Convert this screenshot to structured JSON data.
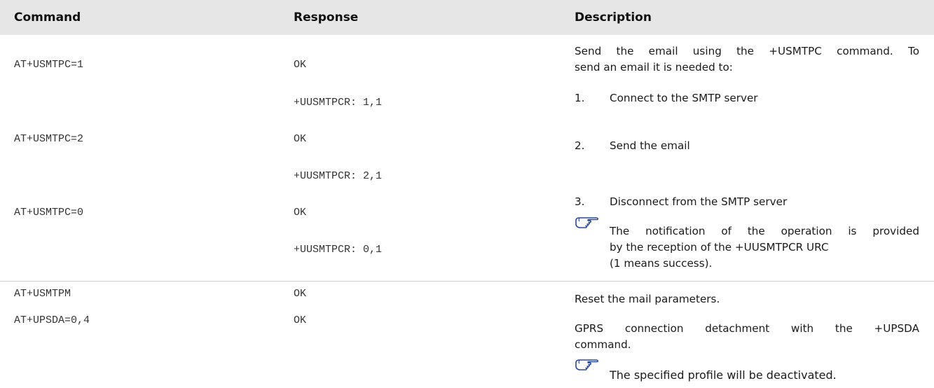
{
  "header": {
    "command": "Command",
    "response": "Response",
    "description": "Description"
  },
  "group1": {
    "rows": [
      {
        "command": "AT+USMTPC=1",
        "response": "OK"
      },
      {
        "response": "+UUSMTPCR: 1,1"
      },
      {
        "command": "AT+USMTPC=2",
        "response": "OK"
      },
      {
        "response": "+UUSMTPCR: 2,1"
      },
      {
        "command": "AT+USMTPC=0",
        "response": "OK"
      },
      {
        "response": "+UUSMTPCR: 0,1"
      }
    ],
    "desc_intro_line1": "Send the email using the +USMTPC command. To",
    "desc_intro_line2": "send an email it is needed to:",
    "steps": [
      {
        "num": "1.",
        "text": "Connect to the SMTP server"
      },
      {
        "num": "2.",
        "text": "Send the email"
      },
      {
        "num": "3.",
        "text": "Disconnect from the SMTP server"
      }
    ],
    "note_line1": "The notification of the operation is provided",
    "note_line2": "by the reception of the +UUSMTPCR URC",
    "note_line3": "(1 means success)."
  },
  "group2": {
    "rows": [
      {
        "command": "AT+USMTPM",
        "response": "OK",
        "description": "Reset the mail parameters."
      },
      {
        "command": "AT+UPSDA=0,4",
        "response": "OK"
      }
    ],
    "desc_line1": "GPRS connection detachment with the +UPSDA",
    "desc_line2": "command.",
    "note": "The specified profile will be deactivated."
  },
  "icons": {
    "note": "pointing-hand-icon"
  }
}
